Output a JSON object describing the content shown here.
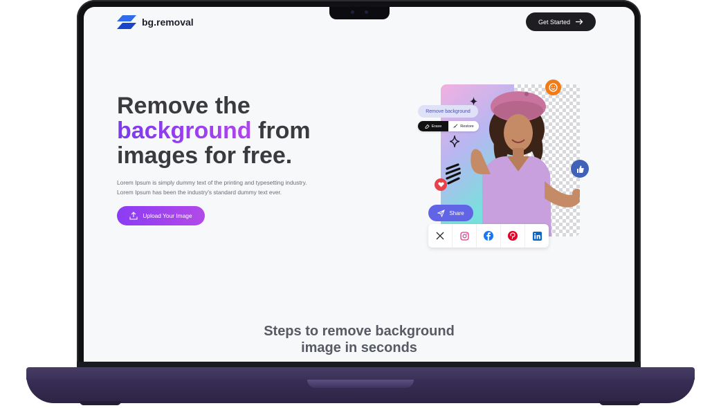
{
  "brand": {
    "name": "bg.removal",
    "accent": "#8b3cf4"
  },
  "header": {
    "cta_label": "Get Started"
  },
  "hero": {
    "title_line1": "Remove the",
    "title_accent": "background",
    "title_after_accent": " from",
    "title_line3": "images for free.",
    "description_line1": "Lorem Ipsum is simply dummy text of the printing and typesetting industry.",
    "description_line2": "Lorem Ipsum has been the industry's standard dummy text ever.",
    "upload_label": "Upload Your Image"
  },
  "editor": {
    "remove_bg_label": "Remove background",
    "erase_label": "Erase",
    "restore_label": "Restore",
    "share_label": "Share",
    "social_icons": [
      "x-icon",
      "instagram-icon",
      "facebook-icon",
      "pinterest-icon",
      "linkedin-icon"
    ]
  },
  "steps": {
    "title_line1": "Steps to remove background",
    "title_line2": "image in seconds"
  }
}
